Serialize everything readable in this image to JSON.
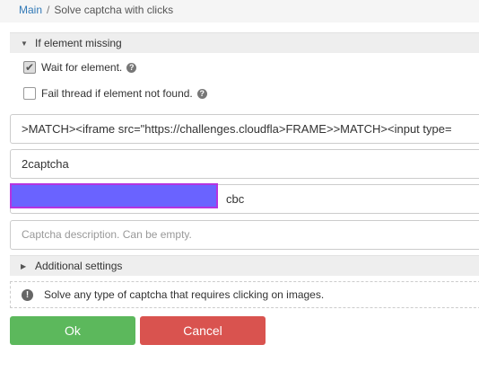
{
  "breadcrumb": {
    "root": "Main",
    "separator": "/",
    "current": "Solve captcha with clicks"
  },
  "sections": {
    "if_element_missing": "If element missing",
    "additional_settings": "Additional settings"
  },
  "options": {
    "wait_for_element": {
      "label": "Wait for element.",
      "checked": true
    },
    "fail_thread": {
      "label": "Fail thread if element not found.",
      "checked": false
    }
  },
  "fields": {
    "selector": ">MATCH><iframe src=\"https://challenges.cloudfla>FRAME>>MATCH><input type=",
    "service": "2captcha",
    "key_suffix": "cbc",
    "description_placeholder": "Captcha description. Can be empty."
  },
  "info": {
    "text": "Solve any type of captcha that requires clicking on images."
  },
  "buttons": {
    "ok": "Ok",
    "cancel": "Cancel"
  },
  "icons": {
    "help": "?",
    "info": "!",
    "expanded_arrow": "▼",
    "collapsed_arrow": "▶",
    "check": "✔"
  },
  "colors": {
    "link": "#337ab7",
    "ok": "#5cb85c",
    "cancel": "#d9534f",
    "redaction_fill": "#6a63ff",
    "redaction_border": "#b633e0"
  }
}
